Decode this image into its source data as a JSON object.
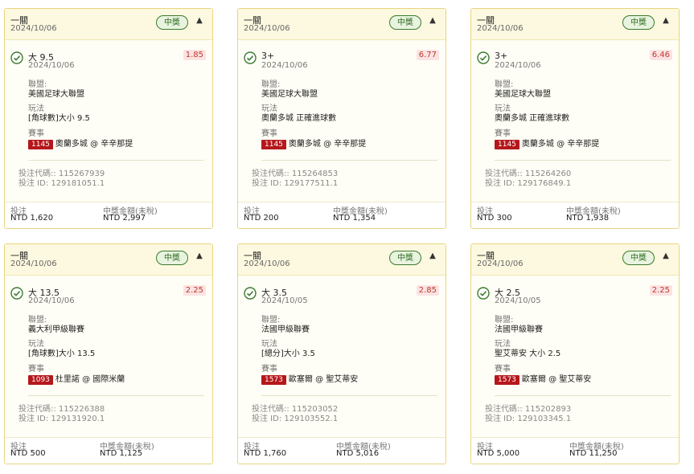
{
  "cards": [
    {
      "bet_type": "一關",
      "bet_date": "2024/10/06",
      "status": "中獎",
      "selection": "大 9.5",
      "selection_date": "2024/10/06",
      "odds": "1.85",
      "league_label": "聯盟:",
      "league": "美國足球大聯盟",
      "market_label": "玩法",
      "market": "[角球數]大小 9.5",
      "event_label": "賽事",
      "match_id": "1145",
      "match": "奧蘭多城 @ 辛辛那提",
      "code": "投注代碼:: 115267939",
      "bet_id": "投注 ID: 129181051.1",
      "stake_label": "投注",
      "stake": "NTD 1,620",
      "win_label": "中獎金額(未稅)",
      "win": "NTD 2,997"
    },
    {
      "bet_type": "一關",
      "bet_date": "2024/10/06",
      "status": "中獎",
      "selection": "3+",
      "selection_date": "2024/10/06",
      "odds": "6.77",
      "league_label": "聯盟:",
      "league": "美國足球大聯盟",
      "market_label": "玩法",
      "market": "奧蘭多城 正確進球數",
      "event_label": "賽事",
      "match_id": "1145",
      "match": "奧蘭多城 @ 辛辛那提",
      "code": "投注代碼:: 115264853",
      "bet_id": "投注 ID: 129177511.1",
      "stake_label": "投注",
      "stake": "NTD 200",
      "win_label": "中獎金額(未稅)",
      "win": "NTD 1,354"
    },
    {
      "bet_type": "一關",
      "bet_date": "2024/10/06",
      "status": "中獎",
      "selection": "3+",
      "selection_date": "2024/10/06",
      "odds": "6.46",
      "league_label": "聯盟:",
      "league": "美國足球大聯盟",
      "market_label": "玩法",
      "market": "奧蘭多城 正確進球數",
      "event_label": "賽事",
      "match_id": "1145",
      "match": "奧蘭多城 @ 辛辛那提",
      "code": "投注代碼:: 115264260",
      "bet_id": "投注 ID: 129176849.1",
      "stake_label": "投注",
      "stake": "NTD 300",
      "win_label": "中獎金額(未稅)",
      "win": "NTD 1,938"
    },
    {
      "bet_type": "一關",
      "bet_date": "2024/10/06",
      "status": "中獎",
      "selection": "大 13.5",
      "selection_date": "2024/10/06",
      "odds": "2.25",
      "league_label": "聯盟:",
      "league": "義大利甲級聯賽",
      "market_label": "玩法",
      "market": "[角球數]大小 13.5",
      "event_label": "賽事",
      "match_id": "1093",
      "match": "杜里諾 @ 國際米蘭",
      "code": "投注代碼:: 115226388",
      "bet_id": "投注 ID: 129131920.1",
      "stake_label": "投注",
      "stake": "NTD 500",
      "win_label": "中獎金額(未稅)",
      "win": "NTD 1,125"
    },
    {
      "bet_type": "一關",
      "bet_date": "2024/10/06",
      "status": "中獎",
      "selection": "大 3.5",
      "selection_date": "2024/10/05",
      "odds": "2.85",
      "league_label": "聯盟:",
      "league": "法國甲級聯賽",
      "market_label": "玩法",
      "market": "[總分]大小 3.5",
      "event_label": "賽事",
      "match_id": "1573",
      "match": "歐塞爾 @ 聖艾蒂安",
      "code": "投注代碼:: 115203052",
      "bet_id": "投注 ID: 129103552.1",
      "stake_label": "投注",
      "stake": "NTD 1,760",
      "win_label": "中獎金額(未稅)",
      "win": "NTD 5,016"
    },
    {
      "bet_type": "一關",
      "bet_date": "2024/10/06",
      "status": "中獎",
      "selection": "大 2.5",
      "selection_date": "2024/10/05",
      "odds": "2.25",
      "league_label": "聯盟:",
      "league": "法國甲級聯賽",
      "market_label": "玩法",
      "market": "聖艾蒂安 大小 2.5",
      "event_label": "賽事",
      "match_id": "1573",
      "match": "歐塞爾 @ 聖艾蒂安",
      "code": "投注代碼:: 115202893",
      "bet_id": "投注 ID: 129103345.1",
      "stake_label": "投注",
      "stake": "NTD 5,000",
      "win_label": "中獎金額(未稅)",
      "win": "NTD 11,250"
    }
  ]
}
